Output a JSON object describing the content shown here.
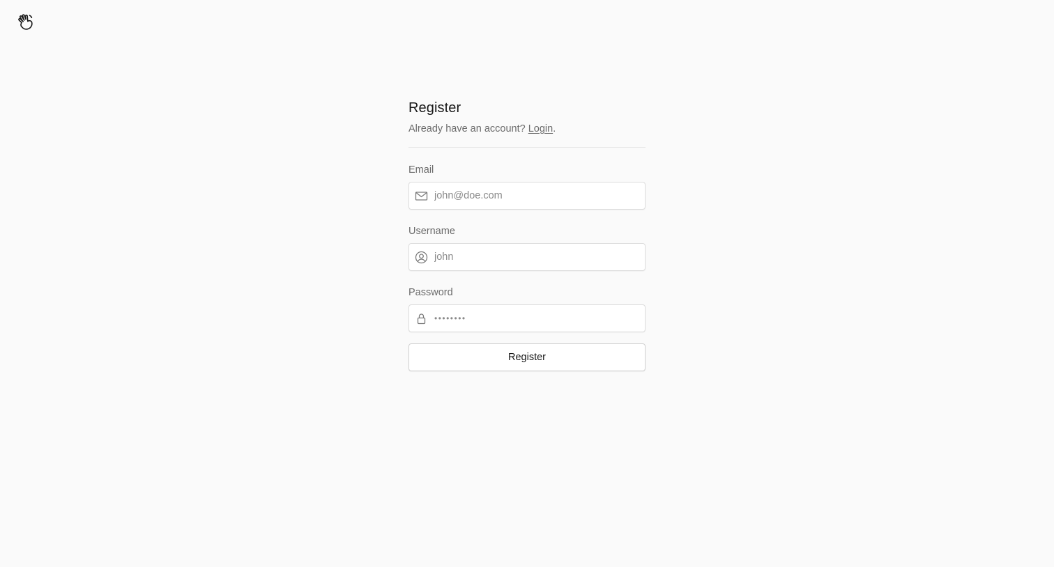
{
  "register": {
    "title": "Register",
    "subtitle_prefix": "Already have an account? ",
    "login_link": "Login",
    "subtitle_suffix": ".",
    "email_label": "Email",
    "email_placeholder": "john@doe.com",
    "username_label": "Username",
    "username_placeholder": "john",
    "password_label": "Password",
    "password_placeholder": "••••••••",
    "submit_label": "Register"
  },
  "icons": {
    "logo": "waving-hand-icon",
    "email": "mail-icon",
    "username": "user-circle-icon",
    "password": "lock-icon"
  },
  "colors": {
    "background": "#fafafa",
    "text_primary": "#171717",
    "text_secondary": "#6b6b6b",
    "border": "#dcdcdc"
  }
}
